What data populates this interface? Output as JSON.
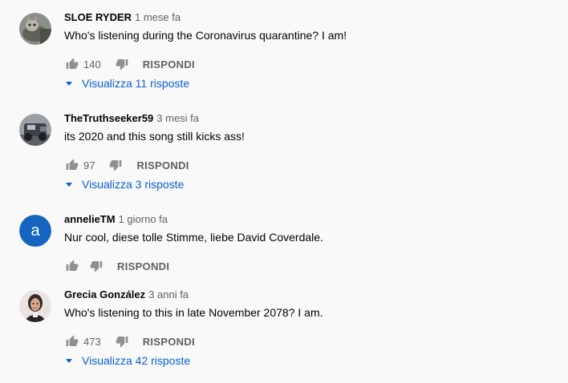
{
  "comments": [
    {
      "author": "SLOE RYDER",
      "time": "1 mese fa",
      "text": "Who's listening during the Coronavirus quarantine?  I am!",
      "likes": "140",
      "reply_label": "RISPONDI",
      "view_replies": "Visualizza 11 risposte"
    },
    {
      "author": "TheTruthseeker59",
      "time": "3 mesi fa",
      "text": "its 2020 and this song still kicks ass!",
      "likes": "97",
      "reply_label": "RISPONDI",
      "view_replies": "Visualizza 3 risposte"
    },
    {
      "author": "annelieTM",
      "time": "1 giorno fa",
      "text": "Nur cool, diese tolle Stimme, liebe David Coverdale.",
      "avatar_letter": "a",
      "reply_label": "RISPONDI"
    },
    {
      "author": "Grecia González",
      "time": "3 anni fa",
      "text": "Who's listening to this in late November 2078? I am.",
      "likes": "473",
      "reply_label": "RISPONDI",
      "view_replies": "Visualizza 42 risposte"
    }
  ],
  "colors": {
    "background": "#f9f9f9",
    "link": "#065fd4",
    "secondary_text": "#606060",
    "avatar_blue": "#1565c0"
  },
  "icons": [
    "thumb-up-icon",
    "thumb-down-icon",
    "chevron-down-icon"
  ]
}
